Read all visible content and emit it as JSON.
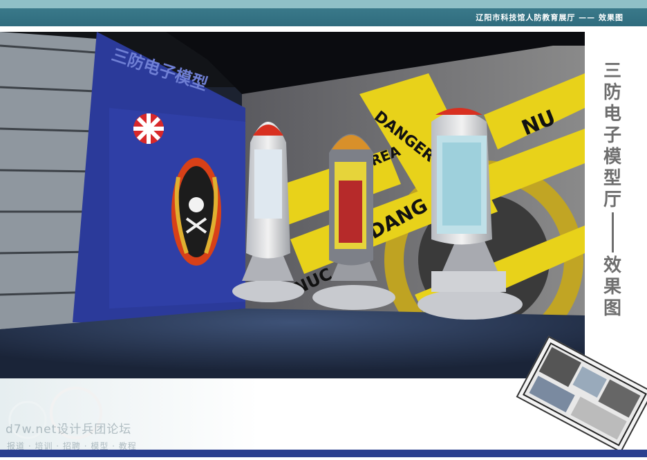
{
  "header": {
    "title": "辽阳市科技馆人防教育展厅 —— 效果图"
  },
  "side": {
    "title_chars": [
      "三",
      "防",
      "电",
      "子",
      "模",
      "型",
      "厅"
    ],
    "subtitle_chars": [
      "效",
      "果",
      "图"
    ]
  },
  "scene": {
    "wall_sign": "三防电子模型",
    "tape_texts": [
      "DANGER AREA",
      "AREA",
      "DANG",
      "NUC",
      "NU"
    ]
  },
  "watermark": {
    "line1": "d7w.net设计兵团论坛",
    "line2": "报道 · 培训 · 招聘 · 模型 · 教程"
  },
  "colors": {
    "header_teal": "#2f6c7e",
    "wall_blue": "#2b3a9a",
    "tape_yellow": "#e8d21a",
    "title_gray": "#6e6e6e"
  }
}
